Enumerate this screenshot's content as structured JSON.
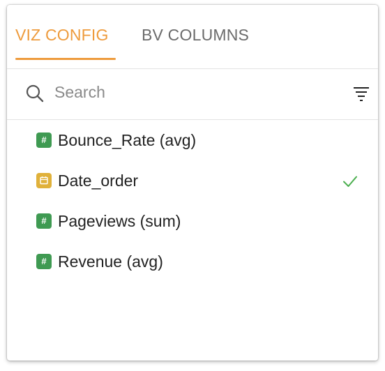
{
  "tabs": [
    {
      "label": "VIZ CONFIG",
      "active": true
    },
    {
      "label": "BV COLUMNS",
      "active": false
    }
  ],
  "search": {
    "placeholder": "Search",
    "value": ""
  },
  "columns": [
    {
      "label": "Bounce_Rate (avg)",
      "type_icon": "number-icon",
      "badge": "#",
      "selected": false
    },
    {
      "label": "Date_order",
      "type_icon": "calendar-icon",
      "badge": "",
      "selected": true
    },
    {
      "label": "Pageviews (sum)",
      "type_icon": "number-icon",
      "badge": "#",
      "selected": false
    },
    {
      "label": "Revenue (avg)",
      "type_icon": "number-icon",
      "badge": "#",
      "selected": false
    }
  ],
  "colors": {
    "accent": "#ee9b3c",
    "inactive_tab": "#6b6b6b",
    "number_badge": "#3f9a52",
    "date_badge": "#e0b13a",
    "check": "#4caf50"
  }
}
